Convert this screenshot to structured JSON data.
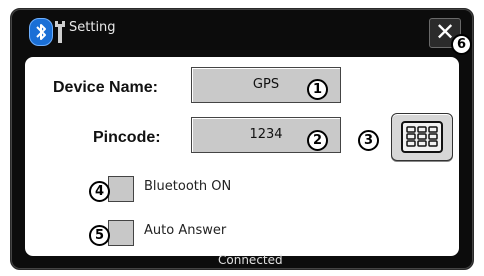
{
  "window": {
    "title": "Setting",
    "close_glyph": "✕"
  },
  "icons": [
    "bluetooth-icon",
    "wrench-icon",
    "close-icon",
    "keypad-icon"
  ],
  "form": {
    "device_name": {
      "label": "Device Name:",
      "value": "GPS"
    },
    "pincode": {
      "label": "Pincode:",
      "value": "1234"
    },
    "bluetooth_on": {
      "label": "Bluetooth ON",
      "checked": false
    },
    "auto_answer": {
      "label": "Auto Answer",
      "checked": false
    }
  },
  "badges": {
    "b1": "1",
    "b2": "2",
    "b3": "3",
    "b4": "4",
    "b5": "5",
    "b6": "6"
  },
  "status": {
    "text": "Connected"
  },
  "colors": {
    "window_bg": "#0c0c0c",
    "field_bg": "#c9c9c9",
    "accent_blue": "#1a6fd6"
  }
}
